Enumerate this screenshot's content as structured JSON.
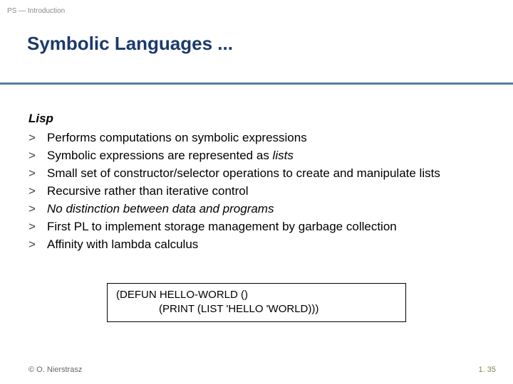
{
  "breadcrumb": "PS — Introduction",
  "title": "Symbolic Languages ...",
  "subhead": "Lisp",
  "marker": ">",
  "bullets": [
    {
      "pre": "Performs computations on symbolic expressions"
    },
    {
      "pre": "Symbolic expressions are represented as ",
      "ital": "lists"
    },
    {
      "pre": "Small set of constructor/selector operations to create and manipulate lists"
    },
    {
      "pre": "Recursive rather than iterative control"
    },
    {
      "ital_full": "No distinction between data and programs"
    },
    {
      "pre": "First PL to implement storage management by garbage collection"
    },
    {
      "pre": "Affinity with lambda calculus"
    }
  ],
  "code": {
    "line1": "(DEFUN HELLO-WORLD ()",
    "line2": "(PRINT (LIST 'HELLO 'WORLD)))"
  },
  "footer": {
    "left": "© O. Nierstrasz",
    "right": "1. 35"
  }
}
